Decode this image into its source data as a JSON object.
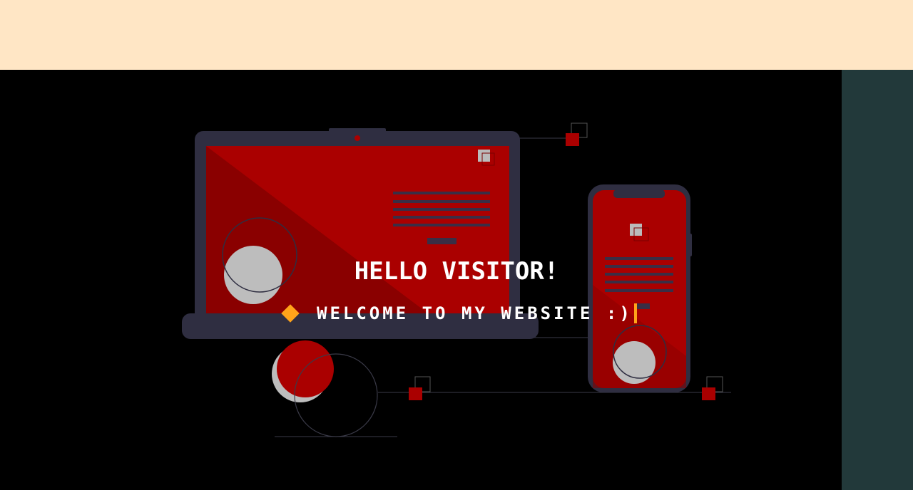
{
  "header": {
    "bg_color": "#ffe6c5"
  },
  "hero": {
    "title": "HELLO VISITOR!",
    "subtitle": "WELCOME TO MY WEBSITE :)",
    "bullet_icon": "diamond-icon",
    "accent_color": "#ffa31a",
    "brand_color": "#aa0000"
  },
  "sidepanel": {
    "bg_color": "#22393a"
  }
}
